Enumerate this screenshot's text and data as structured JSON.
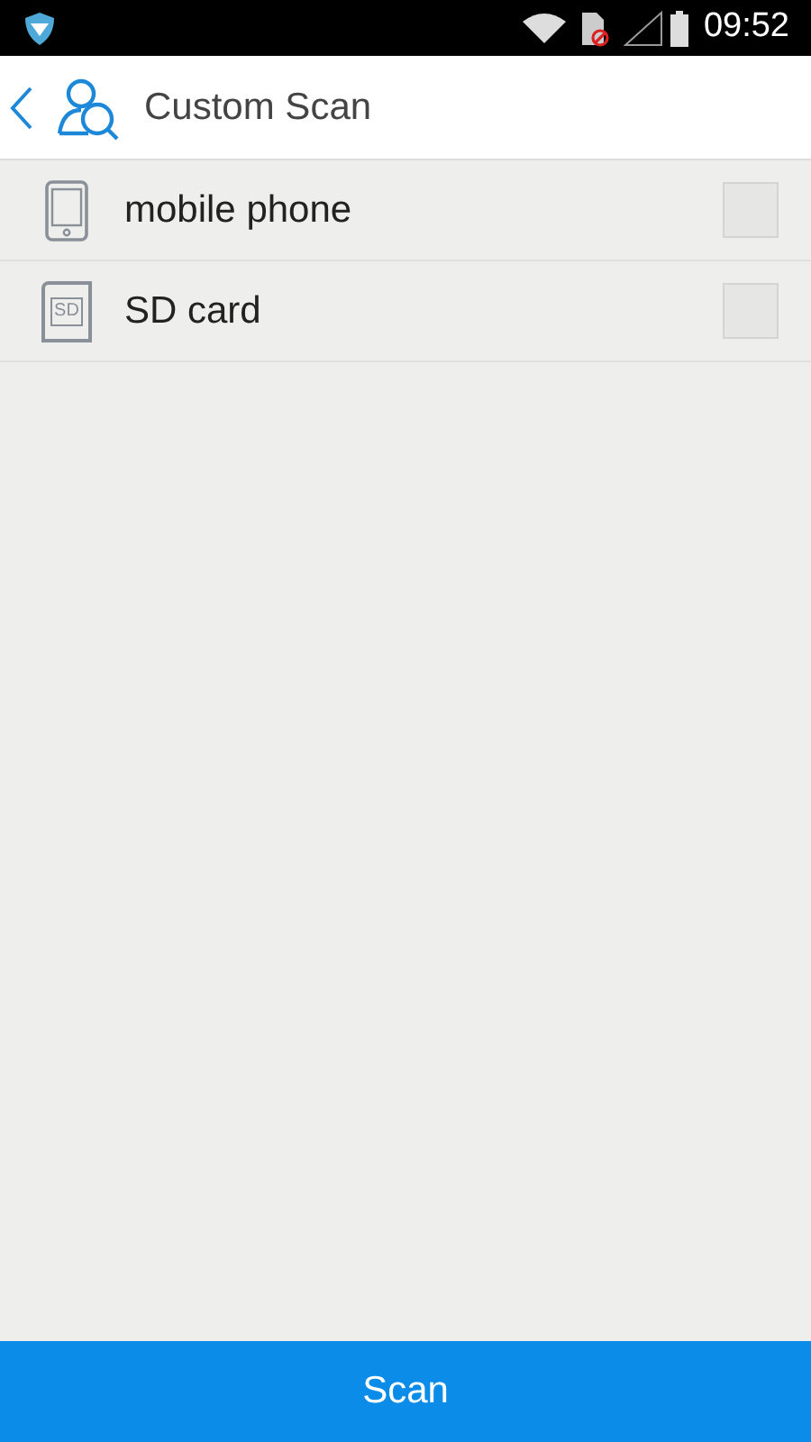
{
  "status_bar": {
    "time": "09:52"
  },
  "header": {
    "title": "Custom Scan"
  },
  "items": [
    {
      "kind": "phone",
      "label": "mobile phone",
      "checked": false
    },
    {
      "kind": "sd",
      "label": "SD card",
      "icon_text": "SD",
      "checked": false
    }
  ],
  "scan_button": {
    "label": "Scan"
  }
}
